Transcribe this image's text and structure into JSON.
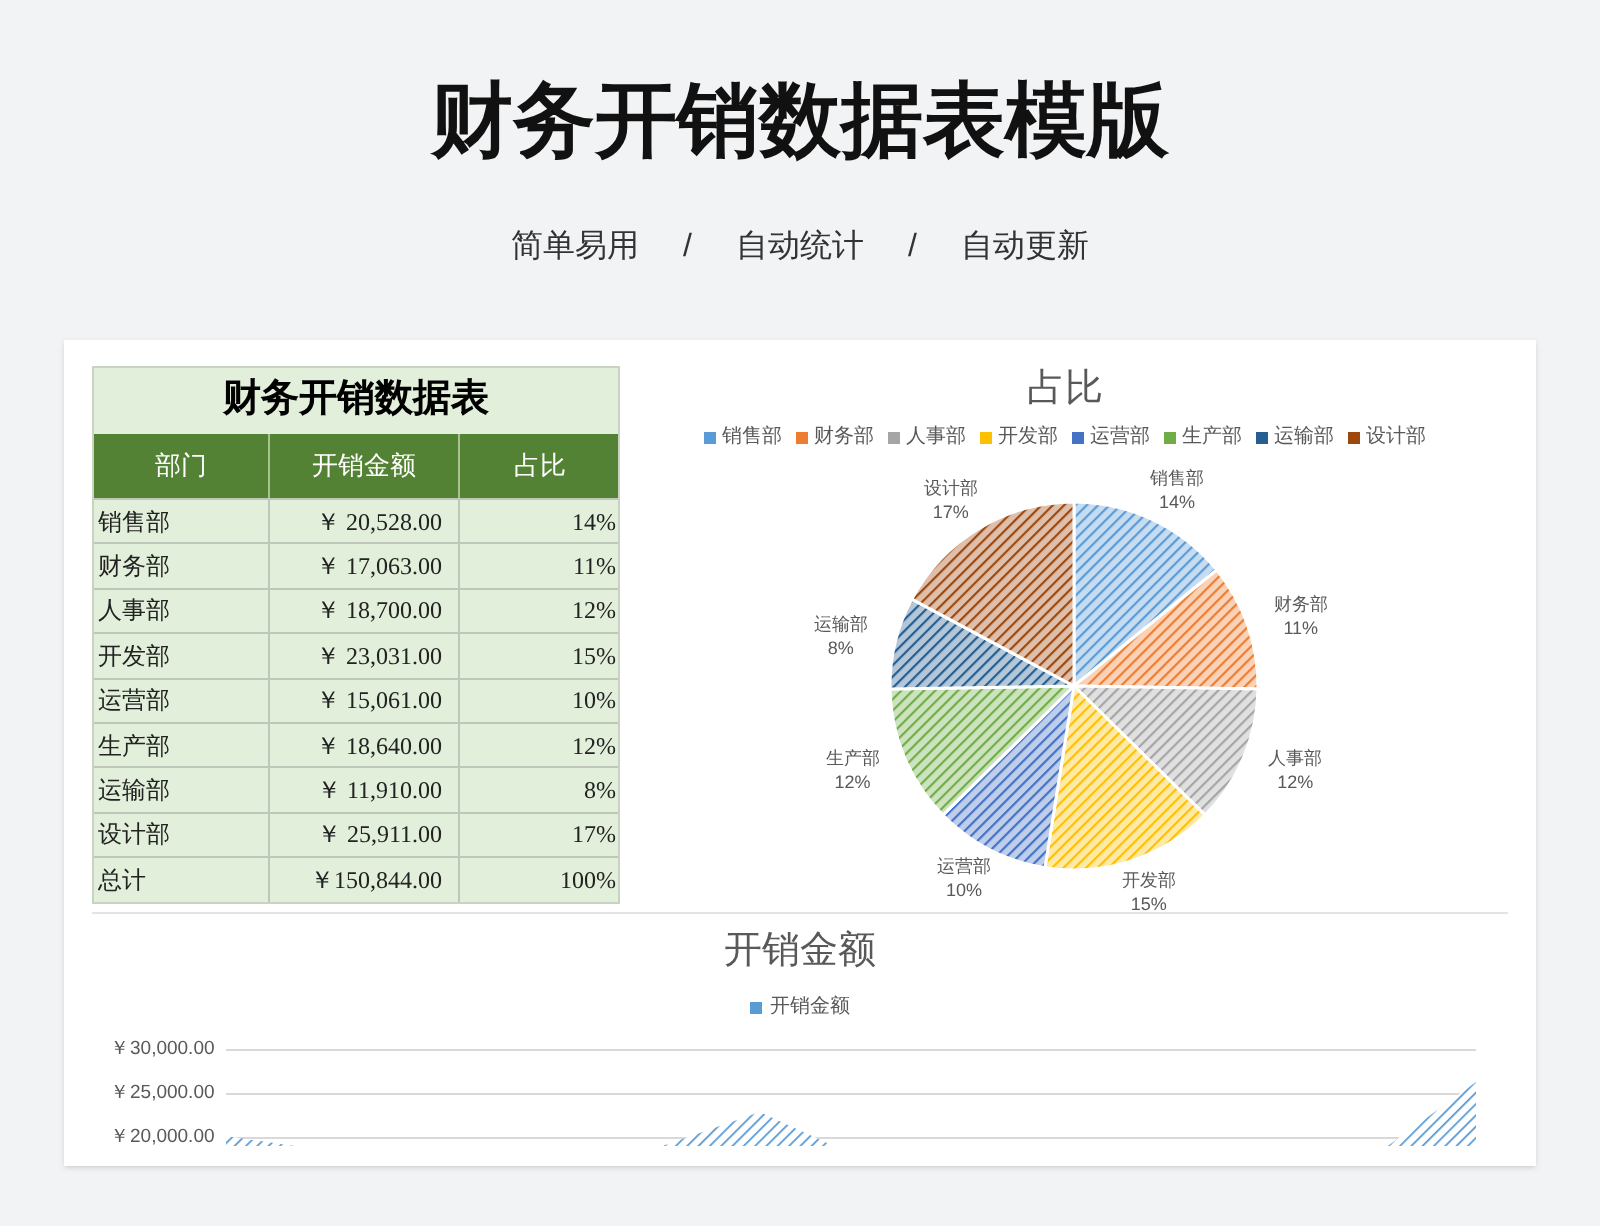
{
  "header": {
    "title": "财务开销数据表模版",
    "features": [
      "简单易用",
      "/",
      "自动统计",
      "/",
      "自动更新"
    ]
  },
  "table": {
    "title": "财务开销数据表",
    "columns": [
      "部门",
      "开销金额",
      "占比"
    ],
    "rows": [
      [
        "销售部",
        "￥ 20,528.00",
        "14%"
      ],
      [
        "财务部",
        "￥ 17,063.00",
        "11%"
      ],
      [
        "人事部",
        "￥ 18,700.00",
        "12%"
      ],
      [
        "开发部",
        "￥ 23,031.00",
        "15%"
      ],
      [
        "运营部",
        "￥ 15,061.00",
        "10%"
      ],
      [
        "生产部",
        "￥ 18,640.00",
        "12%"
      ],
      [
        "运输部",
        "￥ 11,910.00",
        "8%"
      ],
      [
        "设计部",
        "￥ 25,911.00",
        "17%"
      ],
      [
        "总计",
        "￥150,844.00",
        "100%"
      ]
    ]
  },
  "pie": {
    "legend": [
      {
        "name": "销售部",
        "color": "#5b9bd5"
      },
      {
        "name": "财务部",
        "color": "#ed7d31"
      },
      {
        "name": "人事部",
        "color": "#a5a5a5"
      },
      {
        "name": "开发部",
        "color": "#ffc000"
      },
      {
        "name": "运营部",
        "color": "#4472c4"
      },
      {
        "name": "生产部",
        "color": "#70ad47"
      },
      {
        "name": "运输部",
        "color": "#255e91"
      },
      {
        "name": "设计部",
        "color": "#9e480e"
      }
    ],
    "chart_data": {
      "type": "pie",
      "title": "占比",
      "categories": [
        "销售部",
        "财务部",
        "人事部",
        "开发部",
        "运营部",
        "生产部",
        "运输部",
        "设计部"
      ],
      "values": [
        14,
        11,
        12,
        15,
        10,
        12,
        8,
        17
      ],
      "value_labels": [
        "14%",
        "11%",
        "12%",
        "15%",
        "10%",
        "12%",
        "8%",
        "17%"
      ]
    }
  },
  "area": {
    "title": "开销金额",
    "legend": {
      "name": "开销金额",
      "color": "#5b9bd5"
    },
    "axis_labels": [
      "￥30,000.00",
      "￥25,000.00",
      "￥20,000.00"
    ]
  }
}
